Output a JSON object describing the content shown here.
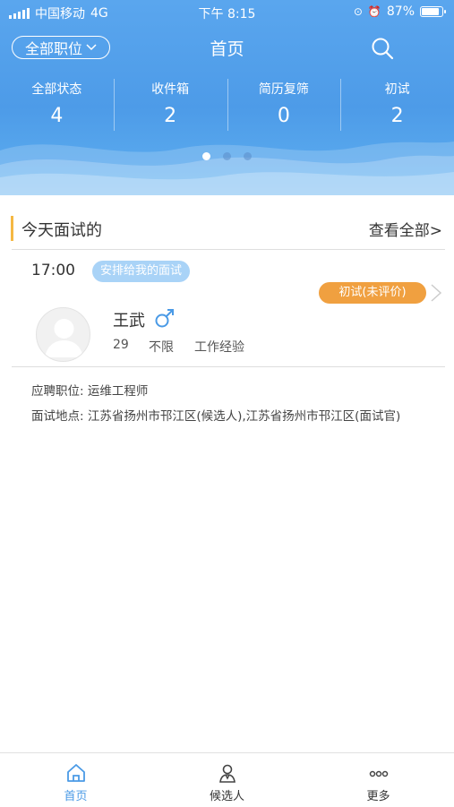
{
  "status_bar": {
    "carrier": "中国移动",
    "network": "4G",
    "time": "下午 8:15",
    "battery": "87%"
  },
  "header": {
    "position_filter": "全部职位",
    "title": "首页",
    "stats": [
      {
        "label": "全部状态",
        "value": "4"
      },
      {
        "label": "收件箱",
        "value": "2"
      },
      {
        "label": "简历复筛",
        "value": "0"
      },
      {
        "label": "初试",
        "value": "2"
      }
    ]
  },
  "section": {
    "title": "今天面试的",
    "view_all": "查看全部>"
  },
  "interview": {
    "time": "17:00",
    "tag": "安排给我的面试",
    "stage": "初试(未评价)",
    "candidate": {
      "name": "王武",
      "gender_icon": "male-icon",
      "age": "29",
      "education": "不限",
      "experience": "工作经验"
    },
    "position_label": "应聘职位:",
    "position_value": "运维工程师",
    "location_label": "面试地点:",
    "location_value": "江苏省扬州市邗江区(候选人),江苏省扬州市邗江区(面试官)"
  },
  "tabs": [
    {
      "label": "首页",
      "icon": "home-icon",
      "active": true
    },
    {
      "label": "候选人",
      "icon": "candidate-icon",
      "active": false
    },
    {
      "label": "更多",
      "icon": "more-icon",
      "active": false
    }
  ],
  "colors": {
    "header_blue": "#4d9be8",
    "accent_yellow": "#f5b843",
    "tag_orange": "#f0a040",
    "tag_blue": "#a9d3f7",
    "active_tab": "#4a9ae6"
  }
}
